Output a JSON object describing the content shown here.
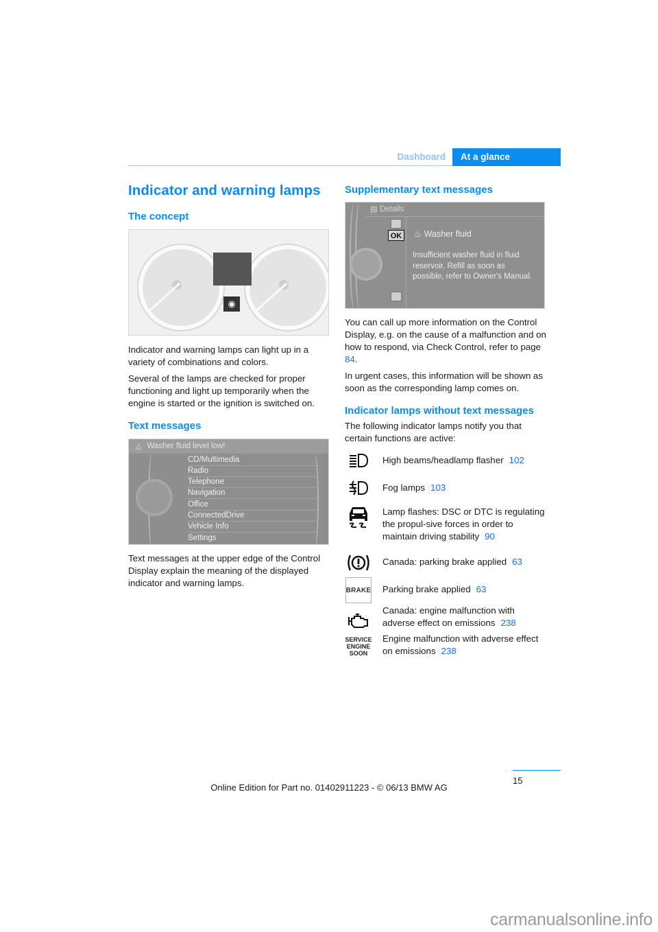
{
  "header": {
    "section": "Dashboard",
    "chapter": "At a glance"
  },
  "left": {
    "title": "Indicator and warning lamps",
    "concept": {
      "heading": "The concept",
      "figure_alt": "Instrument cluster with indicator lamps",
      "paragraphs": [
        "Indicator and warning lamps can light up in a variety of combinations and colors.",
        "Several of the lamps are checked for proper functioning and light up temporarily when the engine is started or the ignition is switched on."
      ]
    },
    "text_messages": {
      "heading": "Text messages",
      "screen": {
        "warning": "Washer fluid level low!",
        "menu_items": [
          "CD/Multimedia",
          "Radio",
          "Telephone",
          "Navigation",
          "Office",
          "ConnectedDrive",
          "Vehicle Info",
          "Settings"
        ]
      },
      "paragraph": "Text messages at the upper edge of the Control Display explain the meaning of the displayed indicator and warning lamps."
    }
  },
  "right": {
    "supplementary": {
      "heading": "Supplementary text messages",
      "screen": {
        "title": "Details",
        "ok_label": "OK",
        "message_title": "Washer fluid",
        "message_body": "Insufficient washer fluid in fluid reservoir. Refill as soon as possible, refer to Owner's Manual."
      },
      "paragraph1_text": "You can call up more information on the Control Display, e.g. on the cause of a malfunction and on how to respond, via Check Control, refer to page ",
      "paragraph1_ref": "84",
      "paragraph1_end": ".",
      "paragraph2": "In urgent cases, this information will be shown as soon as the corresponding lamp comes on."
    },
    "indicator_lamps": {
      "heading": "Indicator lamps without text messages",
      "intro": "The following indicator lamps notify you that certain functions are active:",
      "items": [
        {
          "icon": "high-beam-icon",
          "text": "High beams/headlamp flasher",
          "ref": "102"
        },
        {
          "icon": "fog-lamp-icon",
          "text": "Fog lamps",
          "ref": "103"
        },
        {
          "icon": "dsc-skid-icon",
          "text": "Lamp flashes: DSC or DTC is regulating the propul-sive forces in order to maintain driving stability",
          "ref": "90"
        },
        {
          "icon": "parking-brake-canada-icon",
          "text": "Canada: parking brake applied",
          "ref": "63"
        },
        {
          "icon": "brake-icon",
          "label": "BRAKE",
          "text": "Parking brake applied",
          "ref": "63"
        },
        {
          "icon": "engine-icon",
          "text": "Canada: engine malfunction with adverse effect on emissions",
          "ref": "238"
        },
        {
          "icon": "service-engine-soon-icon",
          "label": "SERVICE ENGINE SOON",
          "text": "Engine malfunction with adverse effect on emissions",
          "ref": "238"
        }
      ]
    }
  },
  "footer": {
    "page_number": "15",
    "edition": "Online Edition for Part no. 01402911223 - © 06/13 BMW AG",
    "watermark": "carmanualsonline.info"
  }
}
